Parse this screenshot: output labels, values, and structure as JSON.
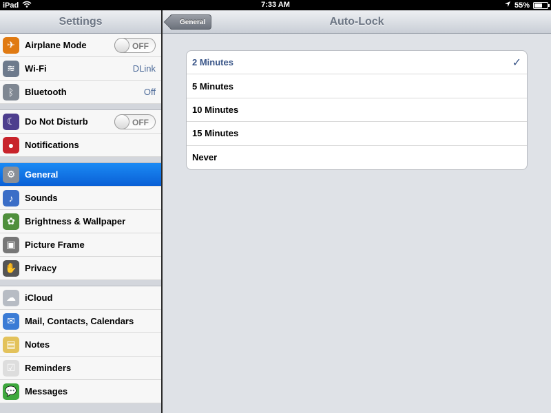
{
  "status_bar": {
    "device": "iPad",
    "time": "7:33 AM",
    "battery": "55%"
  },
  "master": {
    "title": "Settings",
    "groups": [
      [
        {
          "label": "Airplane Mode",
          "toggle": "OFF",
          "icon": "airplane-icon",
          "color": "#e07a12"
        },
        {
          "label": "Wi-Fi",
          "value": "DLink",
          "icon": "wifi-icon",
          "color": "#6d7a8c"
        },
        {
          "label": "Bluetooth",
          "value": "Off",
          "icon": "bluetooth-icon",
          "color": "#7f8792"
        }
      ],
      [
        {
          "label": "Do Not Disturb",
          "toggle": "OFF",
          "icon": "moon-icon",
          "color": "#4d3e8e"
        },
        {
          "label": "Notifications",
          "icon": "notifications-icon",
          "color": "#c8232b"
        }
      ],
      [
        {
          "label": "General",
          "icon": "gear-icon",
          "color": "#8a8f97",
          "selected": true
        },
        {
          "label": "Sounds",
          "icon": "speaker-icon",
          "color": "#3b6ec7"
        },
        {
          "label": "Brightness & Wallpaper",
          "icon": "flower-icon",
          "color": "#4f8f3c"
        },
        {
          "label": "Picture Frame",
          "icon": "picture-frame-icon",
          "color": "#777"
        },
        {
          "label": "Privacy",
          "icon": "hand-icon",
          "color": "#555"
        }
      ],
      [
        {
          "label": "iCloud",
          "icon": "cloud-icon",
          "color": "#b7bcc4"
        },
        {
          "label": "Mail, Contacts, Calendars",
          "icon": "mail-icon",
          "color": "#3a7bd5"
        },
        {
          "label": "Notes",
          "icon": "notes-icon",
          "color": "#e3c25b"
        },
        {
          "label": "Reminders",
          "icon": "reminders-icon",
          "color": "#ddd"
        },
        {
          "label": "Messages",
          "icon": "messages-icon",
          "color": "#3ea83e"
        }
      ]
    ]
  },
  "detail": {
    "title": "Auto-Lock",
    "back_label": "General",
    "options": [
      {
        "label": "2 Minutes",
        "checked": true
      },
      {
        "label": "5 Minutes",
        "checked": false
      },
      {
        "label": "10 Minutes",
        "checked": false
      },
      {
        "label": "15 Minutes",
        "checked": false
      },
      {
        "label": "Never",
        "checked": false
      }
    ]
  }
}
